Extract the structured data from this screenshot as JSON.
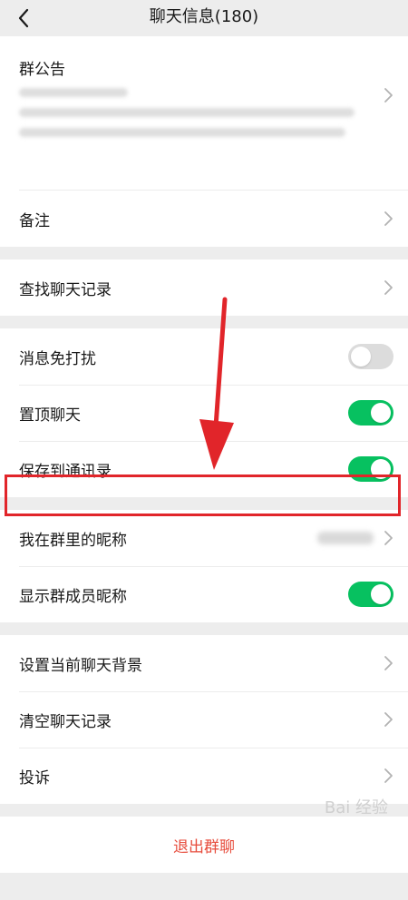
{
  "header": {
    "title": "聊天信息(180)"
  },
  "announcement": {
    "label": "群公告"
  },
  "remark": {
    "label": "备注"
  },
  "search_history": {
    "label": "查找聊天记录"
  },
  "settings": {
    "mute": {
      "label": "消息免打扰",
      "on": false
    },
    "pin": {
      "label": "置顶聊天",
      "on": true
    },
    "save_contacts": {
      "label": "保存到通讯录",
      "on": true
    }
  },
  "nickname": {
    "label": "我在群里的昵称"
  },
  "show_member_names": {
    "label": "显示群成员昵称",
    "on": true
  },
  "background": {
    "label": "设置当前聊天背景"
  },
  "clear_history": {
    "label": "清空聊天记录"
  },
  "report": {
    "label": "投诉"
  },
  "exit": {
    "label": "退出群聊"
  },
  "watermark": {
    "text": "Bai 经验"
  },
  "colors": {
    "accent": "#07c160",
    "danger": "#e74c3c",
    "annotation": "#e1252a"
  }
}
